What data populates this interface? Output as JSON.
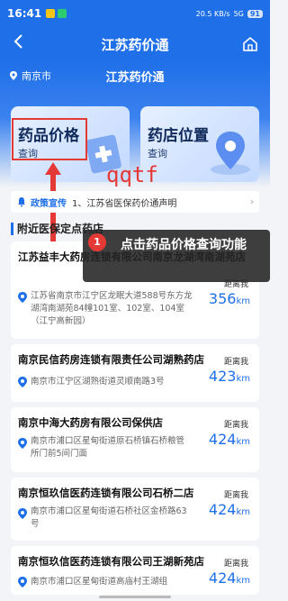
{
  "status": {
    "time": "16:41",
    "net_speed": "20.5 KB/s",
    "signal": "5G",
    "battery": "91"
  },
  "nav": {
    "title": "江苏药价通"
  },
  "location": {
    "city": "南京市",
    "brand": "江苏药价通"
  },
  "cards": [
    {
      "title": "药品价格",
      "sub": "查询"
    },
    {
      "title": "药店位置",
      "sub": "查询"
    }
  ],
  "notice": {
    "tag": "政策宣传",
    "text": "1、江苏省医保药价通声明"
  },
  "watermark": "qqtf",
  "section_title": "附近医保定点药店",
  "tooltip": {
    "step": "1",
    "text": "点击药品价格查询功能"
  },
  "distance_label": "距离我",
  "unit": "km",
  "stores": [
    {
      "name": "江苏益丰大药房连锁有限公司南京龙湖湾南湖苑店",
      "address": "江苏省南京市江宁区龙眠大道588号东方龙湖湾南湖苑84幢101室、102室、104室（江宁高新园）",
      "distance": "356"
    },
    {
      "name": "南京民信药房连锁有限责任公司湖熟药店",
      "address": "南京市江宁区湖熟街道灵顺南路3号",
      "distance": "423"
    },
    {
      "name": "南京中海大药房有限公司保供店",
      "address": "南京市浦口区星甸街道原石桥镇石桥粮管所门前5间门面",
      "distance": "424"
    },
    {
      "name": "南京恒玖信医药连锁有限公司石桥二店",
      "address": "南京市浦口区星甸街道石桥社区金桥路63号",
      "distance": "424"
    },
    {
      "name": "南京恒玖信医药连锁有限公司王湖新苑店",
      "address": "南京市浦口区星甸街道高庙村王湖组",
      "distance": "424"
    }
  ]
}
